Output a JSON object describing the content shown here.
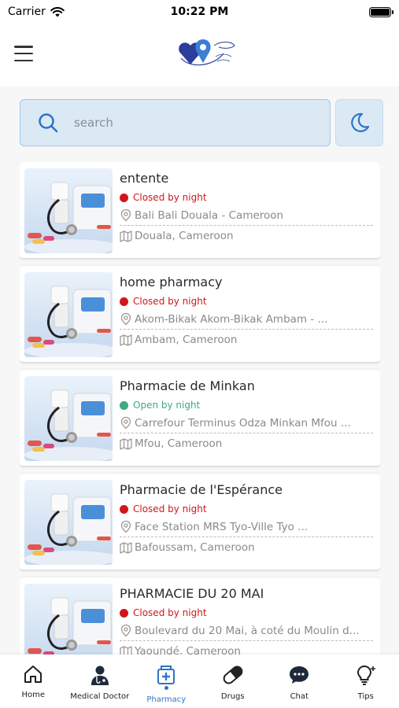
{
  "status_bar": {
    "carrier": "Carrier",
    "time": "10:22 PM"
  },
  "search": {
    "placeholder": "search"
  },
  "colors": {
    "accent": "#2f73c6",
    "closed": "#d0161b",
    "open": "#3dab7a",
    "search_bg": "#dbe9f5"
  },
  "pharmacies": [
    {
      "name": "entente",
      "status": "Closed by night",
      "status_type": "closed",
      "address": "Bali Bali Douala - Cameroon",
      "city": "Douala, Cameroon"
    },
    {
      "name": "home pharmacy",
      "status": "Closed by night",
      "status_type": "closed",
      "address": "Akom-Bikak Akom-Bikak Ambam - ...",
      "city": "Ambam, Cameroon"
    },
    {
      "name": "Pharmacie de Minkan",
      "status": "Open by night",
      "status_type": "open",
      "address": "Carrefour Terminus Odza Minkan Mfou ...",
      "city": "Mfou, Cameroon"
    },
    {
      "name": "Pharmacie de l'Espérance",
      "status": "Closed by night",
      "status_type": "closed",
      "address": "Face Station MRS Tyo-Ville Tyo ...",
      "city": "Bafoussam, Cameroon"
    },
    {
      "name": "PHARMACIE DU 20 MAI",
      "status": "Closed by night",
      "status_type": "closed",
      "address": "Boulevard du 20 Mai, à coté du Moulin d...",
      "city": "Yaoundé, Cameroon"
    }
  ],
  "tabs": [
    {
      "label": "Home",
      "icon": "home-icon",
      "active": false
    },
    {
      "label": "Medical Doctor",
      "icon": "doctor-icon",
      "active": false
    },
    {
      "label": "Pharmacy",
      "icon": "pharmacy-icon",
      "active": true
    },
    {
      "label": "Drugs",
      "icon": "pill-icon",
      "active": false
    },
    {
      "label": "Chat",
      "icon": "chat-icon",
      "active": false
    },
    {
      "label": "Tips",
      "icon": "lightbulb-icon",
      "active": false
    }
  ]
}
